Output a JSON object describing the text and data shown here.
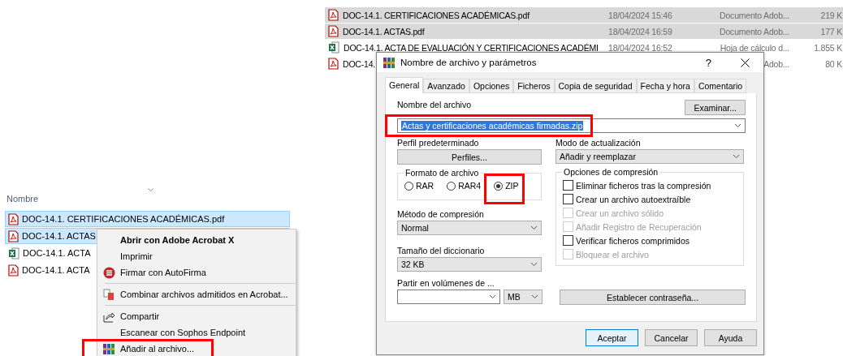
{
  "explorer": {
    "column_header": "Nombre",
    "files": [
      {
        "name": "DOC-14.1. CERTIFICACIONES ACADÉMICAS.pdf",
        "kind": "pdf",
        "selected": true
      },
      {
        "name": "DOC-14.1. ACTAS",
        "kind": "pdf",
        "selected": true
      },
      {
        "name": "DOC-14.1. ACTA",
        "kind": "excel",
        "selected": false
      },
      {
        "name": "DOC-14.1. ACTA",
        "kind": "pdf",
        "selected": false
      }
    ]
  },
  "context_menu": {
    "items": [
      {
        "kind": "plain",
        "label": "Abrir con Adobe Acrobat X",
        "bold": true,
        "highlighted": false
      },
      {
        "kind": "plain",
        "label": "Imprimir",
        "bold": false,
        "highlighted": false
      },
      {
        "kind": "sign",
        "label": "Firmar con AutoFirma",
        "bold": false,
        "highlighted": false
      },
      {
        "kind": "separator"
      },
      {
        "kind": "combine",
        "label": "Combinar archivos admitidos en Acrobat...",
        "bold": false,
        "highlighted": false
      },
      {
        "kind": "separator"
      },
      {
        "kind": "share",
        "label": "Compartir",
        "bold": false,
        "highlighted": false
      },
      {
        "kind": "plain",
        "label": "Escanear con Sophos Endpoint",
        "bold": false,
        "highlighted": false
      },
      {
        "kind": "archive",
        "label": "Añadir al archivo...",
        "bold": false,
        "highlighted": true
      }
    ]
  },
  "file_list": {
    "rows": [
      {
        "name": "DOC-14.1. CERTIFICACIONES ACADÉMICAS.pdf",
        "date": "18/04/2024 15:46",
        "type_label": "Documento Adob...",
        "size": "219 K",
        "kind": "pdf",
        "selected": true
      },
      {
        "name": "DOC-14.1. ACTAS.pdf",
        "date": "18/04/2024 16:59",
        "type_label": "Documento Adob...",
        "size": "177 K",
        "kind": "pdf",
        "selected": true
      },
      {
        "name": "DOC-14.1. ACTA DE EVALUACIÓN Y CERTIFICACIONES ACADÉMI",
        "date": "18/04/2024 16:52",
        "type_label": "Hoja de cálculo d...",
        "size": "1.855 K",
        "kind": "excel",
        "selected": false
      },
      {
        "name": "DOC-14.",
        "type_label": "Adob...",
        "size": "80 K",
        "kind": "pdf",
        "selected": false
      }
    ]
  },
  "dialog": {
    "title": "Nombre de archivo y parámetros",
    "help": "?",
    "tabs": [
      {
        "label": "General",
        "selected": true
      },
      {
        "label": "Avanzado",
        "selected": false
      },
      {
        "label": "Opciones",
        "selected": false
      },
      {
        "label": "Ficheros",
        "selected": false
      },
      {
        "label": "Copia de seguridad",
        "selected": false
      },
      {
        "label": "Fecha y hora",
        "selected": false
      },
      {
        "label": "Comentario",
        "selected": false
      }
    ],
    "archive_name": {
      "label": "Nombre del archivo",
      "value": "Actas y certificaciones académicas firmadas.zip",
      "browse": "Examinar...",
      "highlighted": true
    },
    "profile": {
      "label": "Perfil predeterminado",
      "button": "Perfiles..."
    },
    "update_mode": {
      "label": "Modo de actualización",
      "value": "Añadir y reemplazar"
    },
    "format": {
      "label": "Formato de archivo",
      "options": [
        {
          "label": "RAR",
          "selected": false,
          "highlighted": false
        },
        {
          "label": "RAR4",
          "selected": false,
          "highlighted": false
        },
        {
          "label": "ZIP",
          "selected": true,
          "highlighted": true
        }
      ]
    },
    "method": {
      "label": "Método de compresión",
      "value": "Normal"
    },
    "dictionary": {
      "label": "Tamaño del diccionario",
      "value": "32 KB"
    },
    "volumes": {
      "label": "Partir en volúmenes de ...",
      "unit": "MB"
    },
    "options": {
      "label": "Opciones de compresión",
      "items": [
        {
          "label": "Eliminar ficheros tras la compresión",
          "checked": false,
          "disabled": false
        },
        {
          "label": "Crear un archivo autoextraíble",
          "checked": false,
          "disabled": false
        },
        {
          "label": "Crear un archivo sólido",
          "checked": false,
          "disabled": true
        },
        {
          "label": "Añadir Registro de Recuperación",
          "checked": false,
          "disabled": true
        },
        {
          "label": "Verificar ficheros comprimidos",
          "checked": false,
          "disabled": false
        },
        {
          "label": "Bloquear el archivo",
          "checked": false,
          "disabled": true
        }
      ]
    },
    "password_button": "Establecer contraseña...",
    "buttons": [
      {
        "label": "Aceptar",
        "default": true
      },
      {
        "label": "Cancelar",
        "default": false
      },
      {
        "label": "Ayuda",
        "default": false
      }
    ]
  }
}
